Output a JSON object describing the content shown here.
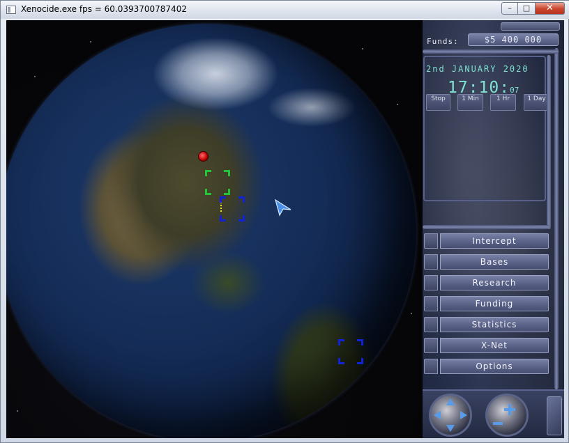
{
  "window": {
    "title": "Xenocide.exe  fps = 60.0393700787402",
    "min_label": "–",
    "max_label": "□",
    "close_label": "✕"
  },
  "geoscape": {
    "funds_label": "Funds:",
    "funds_value": "$5 400 000",
    "date": "2nd JANUARY 2020",
    "time_hm": "17:10",
    "time_sec": "07",
    "speed_buttons": [
      "Stop",
      "1 Min",
      "1 Hr",
      "1 Day"
    ],
    "menu": [
      "Intercept",
      "Bases",
      "Research",
      "Funding",
      "Statistics",
      "X-Net",
      "Options"
    ]
  },
  "icons": {
    "globe_rotate": "rotate-arrows-icon",
    "globe_zoom": "zoom-plus-minus-icon"
  },
  "colors": {
    "clock_text": "#7fe3d3",
    "panel_bg": "#2b3452",
    "ufo_marker": "#c00000",
    "base_bracket": "#1222d8",
    "craft_bracket": "#23c43a"
  }
}
